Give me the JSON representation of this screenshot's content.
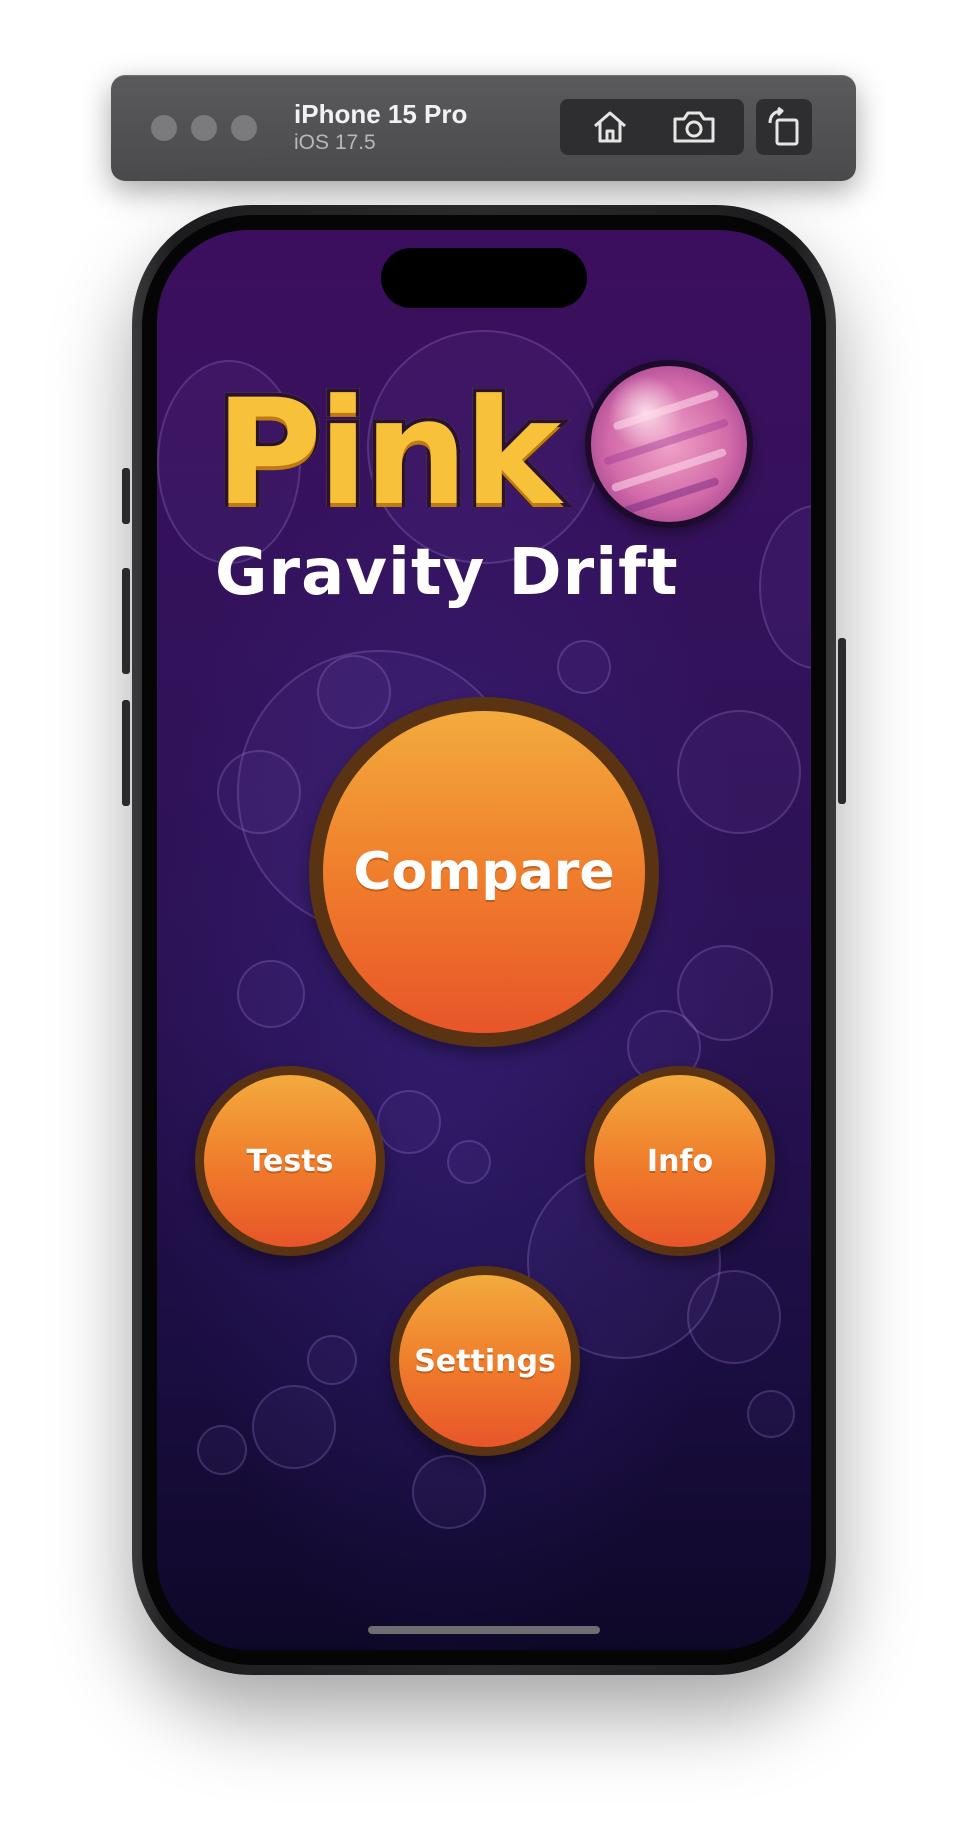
{
  "simulator": {
    "device_name": "iPhone 15 Pro",
    "os_version": "iOS 17.5",
    "icons": [
      "home-icon",
      "screenshot-camera-icon",
      "rotate-icon"
    ]
  },
  "app": {
    "logo_word": "Pink",
    "subtitle": "Gravity Drift",
    "buttons": {
      "compare": "Compare",
      "tests": "Tests",
      "info": "Info",
      "settings": "Settings"
    }
  },
  "colors": {
    "background_top": "#3c0f5e",
    "background_bottom": "#0e0828",
    "button_orange_top": "#f3ab3d",
    "button_orange_bottom": "#e8552a",
    "button_border": "#5a3312",
    "logo_yellow": "#f7c23a"
  }
}
